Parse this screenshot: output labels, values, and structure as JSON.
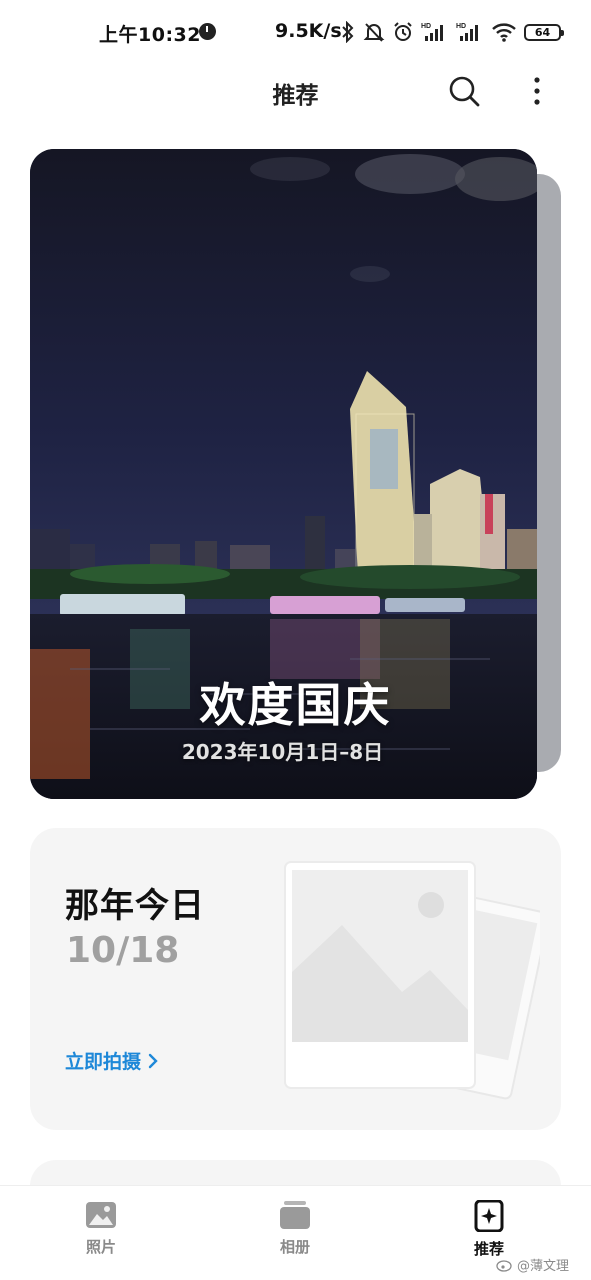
{
  "status_bar": {
    "time": "上午10:32",
    "network_speed": "9.5K/s",
    "battery": "64",
    "icons": [
      "bluetooth-icon",
      "mute-icon",
      "alarm-icon",
      "signal-hd-icon",
      "signal-hd-icon",
      "wifi-icon",
      "battery-icon"
    ]
  },
  "header": {
    "title": "推荐",
    "search_icon": "search-icon",
    "more_icon": "more-vertical-icon"
  },
  "hero_card": {
    "title": "欢度国庆",
    "date_range": "2023年10月1日–8日"
  },
  "on_this_day": {
    "title": "那年今日",
    "date": "10/18",
    "action_label": "立即拍摄",
    "action_icon": "chevron-right-icon"
  },
  "bottom_nav": {
    "items": [
      {
        "label": "照片",
        "icon": "photos-icon",
        "active": false
      },
      {
        "label": "相册",
        "icon": "albums-icon",
        "active": false
      },
      {
        "label": "推荐",
        "icon": "recommend-sparkle-icon",
        "active": true
      }
    ]
  },
  "watermark": {
    "text": "@薄文理"
  },
  "colors": {
    "accent": "#1e88d8",
    "text_primary": "#111111",
    "text_secondary": "#a0a0a0",
    "card_background": "#f5f5f5"
  }
}
